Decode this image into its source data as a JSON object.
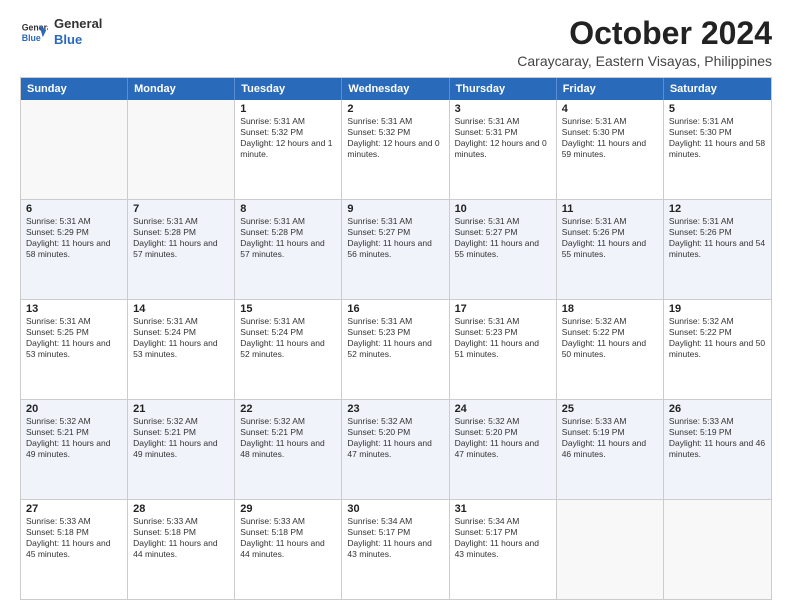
{
  "logo": {
    "line1": "General",
    "line2": "Blue"
  },
  "title": "October 2024",
  "subtitle": "Caraycaray, Eastern Visayas, Philippines",
  "days_of_week": [
    "Sunday",
    "Monday",
    "Tuesday",
    "Wednesday",
    "Thursday",
    "Friday",
    "Saturday"
  ],
  "weeks": [
    [
      {
        "day": "",
        "empty": true
      },
      {
        "day": "",
        "empty": true
      },
      {
        "day": "1",
        "sunrise": "Sunrise: 5:31 AM",
        "sunset": "Sunset: 5:32 PM",
        "daylight": "Daylight: 12 hours and 1 minute."
      },
      {
        "day": "2",
        "sunrise": "Sunrise: 5:31 AM",
        "sunset": "Sunset: 5:32 PM",
        "daylight": "Daylight: 12 hours and 0 minutes."
      },
      {
        "day": "3",
        "sunrise": "Sunrise: 5:31 AM",
        "sunset": "Sunset: 5:31 PM",
        "daylight": "Daylight: 12 hours and 0 minutes."
      },
      {
        "day": "4",
        "sunrise": "Sunrise: 5:31 AM",
        "sunset": "Sunset: 5:30 PM",
        "daylight": "Daylight: 11 hours and 59 minutes."
      },
      {
        "day": "5",
        "sunrise": "Sunrise: 5:31 AM",
        "sunset": "Sunset: 5:30 PM",
        "daylight": "Daylight: 11 hours and 58 minutes."
      }
    ],
    [
      {
        "day": "6",
        "sunrise": "Sunrise: 5:31 AM",
        "sunset": "Sunset: 5:29 PM",
        "daylight": "Daylight: 11 hours and 58 minutes."
      },
      {
        "day": "7",
        "sunrise": "Sunrise: 5:31 AM",
        "sunset": "Sunset: 5:28 PM",
        "daylight": "Daylight: 11 hours and 57 minutes."
      },
      {
        "day": "8",
        "sunrise": "Sunrise: 5:31 AM",
        "sunset": "Sunset: 5:28 PM",
        "daylight": "Daylight: 11 hours and 57 minutes."
      },
      {
        "day": "9",
        "sunrise": "Sunrise: 5:31 AM",
        "sunset": "Sunset: 5:27 PM",
        "daylight": "Daylight: 11 hours and 56 minutes."
      },
      {
        "day": "10",
        "sunrise": "Sunrise: 5:31 AM",
        "sunset": "Sunset: 5:27 PM",
        "daylight": "Daylight: 11 hours and 55 minutes."
      },
      {
        "day": "11",
        "sunrise": "Sunrise: 5:31 AM",
        "sunset": "Sunset: 5:26 PM",
        "daylight": "Daylight: 11 hours and 55 minutes."
      },
      {
        "day": "12",
        "sunrise": "Sunrise: 5:31 AM",
        "sunset": "Sunset: 5:26 PM",
        "daylight": "Daylight: 11 hours and 54 minutes."
      }
    ],
    [
      {
        "day": "13",
        "sunrise": "Sunrise: 5:31 AM",
        "sunset": "Sunset: 5:25 PM",
        "daylight": "Daylight: 11 hours and 53 minutes."
      },
      {
        "day": "14",
        "sunrise": "Sunrise: 5:31 AM",
        "sunset": "Sunset: 5:24 PM",
        "daylight": "Daylight: 11 hours and 53 minutes."
      },
      {
        "day": "15",
        "sunrise": "Sunrise: 5:31 AM",
        "sunset": "Sunset: 5:24 PM",
        "daylight": "Daylight: 11 hours and 52 minutes."
      },
      {
        "day": "16",
        "sunrise": "Sunrise: 5:31 AM",
        "sunset": "Sunset: 5:23 PM",
        "daylight": "Daylight: 11 hours and 52 minutes."
      },
      {
        "day": "17",
        "sunrise": "Sunrise: 5:31 AM",
        "sunset": "Sunset: 5:23 PM",
        "daylight": "Daylight: 11 hours and 51 minutes."
      },
      {
        "day": "18",
        "sunrise": "Sunrise: 5:32 AM",
        "sunset": "Sunset: 5:22 PM",
        "daylight": "Daylight: 11 hours and 50 minutes."
      },
      {
        "day": "19",
        "sunrise": "Sunrise: 5:32 AM",
        "sunset": "Sunset: 5:22 PM",
        "daylight": "Daylight: 11 hours and 50 minutes."
      }
    ],
    [
      {
        "day": "20",
        "sunrise": "Sunrise: 5:32 AM",
        "sunset": "Sunset: 5:21 PM",
        "daylight": "Daylight: 11 hours and 49 minutes."
      },
      {
        "day": "21",
        "sunrise": "Sunrise: 5:32 AM",
        "sunset": "Sunset: 5:21 PM",
        "daylight": "Daylight: 11 hours and 49 minutes."
      },
      {
        "day": "22",
        "sunrise": "Sunrise: 5:32 AM",
        "sunset": "Sunset: 5:21 PM",
        "daylight": "Daylight: 11 hours and 48 minutes."
      },
      {
        "day": "23",
        "sunrise": "Sunrise: 5:32 AM",
        "sunset": "Sunset: 5:20 PM",
        "daylight": "Daylight: 11 hours and 47 minutes."
      },
      {
        "day": "24",
        "sunrise": "Sunrise: 5:32 AM",
        "sunset": "Sunset: 5:20 PM",
        "daylight": "Daylight: 11 hours and 47 minutes."
      },
      {
        "day": "25",
        "sunrise": "Sunrise: 5:33 AM",
        "sunset": "Sunset: 5:19 PM",
        "daylight": "Daylight: 11 hours and 46 minutes."
      },
      {
        "day": "26",
        "sunrise": "Sunrise: 5:33 AM",
        "sunset": "Sunset: 5:19 PM",
        "daylight": "Daylight: 11 hours and 46 minutes."
      }
    ],
    [
      {
        "day": "27",
        "sunrise": "Sunrise: 5:33 AM",
        "sunset": "Sunset: 5:18 PM",
        "daylight": "Daylight: 11 hours and 45 minutes."
      },
      {
        "day": "28",
        "sunrise": "Sunrise: 5:33 AM",
        "sunset": "Sunset: 5:18 PM",
        "daylight": "Daylight: 11 hours and 44 minutes."
      },
      {
        "day": "29",
        "sunrise": "Sunrise: 5:33 AM",
        "sunset": "Sunset: 5:18 PM",
        "daylight": "Daylight: 11 hours and 44 minutes."
      },
      {
        "day": "30",
        "sunrise": "Sunrise: 5:34 AM",
        "sunset": "Sunset: 5:17 PM",
        "daylight": "Daylight: 11 hours and 43 minutes."
      },
      {
        "day": "31",
        "sunrise": "Sunrise: 5:34 AM",
        "sunset": "Sunset: 5:17 PM",
        "daylight": "Daylight: 11 hours and 43 minutes."
      },
      {
        "day": "",
        "empty": true
      },
      {
        "day": "",
        "empty": true
      }
    ]
  ]
}
